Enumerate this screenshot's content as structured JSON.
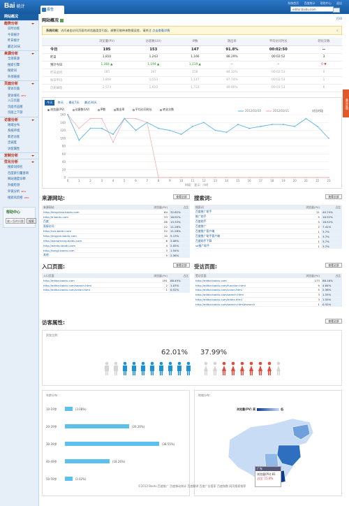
{
  "header": {
    "logo": "Bai",
    "logo_sub": "统计",
    "home_tab": "报告",
    "links": [
      "系统首页",
      "百度统计",
      "帮助中心",
      "退出"
    ],
    "site": "editor.baidu.com"
  },
  "sidebar": {
    "current": "网站概况",
    "groups": [
      {
        "title": "趋势分析",
        "items": [
          "实时访客",
          "今日统计",
          "昨日统计",
          "最近30天"
        ]
      },
      {
        "title": "来源分析",
        "items": [
          "全部来源",
          "搜索引擎",
          "搜索词",
          "外部链接"
        ]
      },
      {
        "title": "页面分析",
        "items": [
          "受访页面",
          "受访域名",
          "入口页面",
          "页面点击图",
          "页面上下游"
        ]
      },
      {
        "title": "访客分析",
        "items": [
          "地域分布",
          "系统环境",
          "新老访客",
          "忠诚度",
          "访客属性"
        ]
      },
      {
        "title": "定制分析",
        "items": []
      },
      {
        "title": "优化分析",
        "items": [
          "搜索词排名",
          "百度索引量查询",
          "网站速度诊断",
          "升级检测",
          "外链分析",
          "搜索风云榜"
        ]
      }
    ],
    "new_badge": "NEW"
  },
  "help": {
    "title": "帮助中心",
    "placeholder": "输入您的问题",
    "button": "搜索"
  },
  "page": {
    "title": "网站概况",
    "print": "打印"
  },
  "alert": {
    "prefix": "系统问候：",
    "text": "访问者由访问页面的浏览器类型引起，调整可能带来数据误差，请关注",
    "link": "点击查看详情"
  },
  "summary": {
    "headers": [
      "",
      "浏览量(PV)",
      "访客数(UV)",
      "IP数",
      "跳出率",
      "平均访问时长",
      "转化次数"
    ],
    "rows": [
      {
        "label": "今日",
        "vals": [
          "195",
          "153",
          "147",
          "91.8%",
          "00:02:50",
          "--"
        ],
        "cls": "big"
      },
      {
        "label": "昨日",
        "vals": [
          "1,810",
          "1,243",
          "1,166",
          "88.29%",
          "00:02:52",
          "3"
        ],
        "cls": ""
      },
      {
        "label": "预计今日",
        "vals": [
          "1,384 ▲",
          "1,194 ▲",
          "1,119 ▲",
          "--",
          "--",
          "0 ▼"
        ],
        "cls": ""
      },
      {
        "label": "昨日此时",
        "vals": [
          "185",
          "167",
          "158",
          "84.32%",
          "00:02:53",
          "0"
        ],
        "cls": "gray"
      },
      {
        "label": "每日平均",
        "vals": [
          "1,809",
          "1,553",
          "1,117",
          "87.74%",
          "00:02:53",
          "1"
        ],
        "cls": "gray"
      },
      {
        "label": "历史峰值",
        "vals": [
          "2,573",
          "1,610",
          "1,722",
          "89.90%",
          "00:03:53",
          "6"
        ],
        "cls": "gray"
      }
    ]
  },
  "trend": {
    "tabs": [
      "今天",
      "昨天",
      "最近7天",
      "最近30天"
    ],
    "metrics": [
      "浏览量(PV)",
      "访客数(UV)",
      "IP数",
      "跳出率",
      "平均访问时长",
      "转化次数"
    ],
    "legend_a": "2012/03/10",
    "legend_b": "2012/03/11",
    "compare": "对比时段",
    "xlabel": "时段：  显示：小时",
    "xticks": [
      "0",
      "1",
      "2",
      "3",
      "4",
      "5",
      "6",
      "7",
      "8",
      "9",
      "10",
      "11",
      "12",
      "13",
      "14",
      "15",
      "16",
      "17",
      "18",
      "19",
      "20",
      "21",
      "22",
      "23"
    ],
    "yticks": [
      "0",
      "20",
      "40",
      "60",
      "80",
      "100",
      "120",
      "140",
      "160"
    ]
  },
  "sources": {
    "title": "来源网站:",
    "btn": "查看全部",
    "headers": [
      "来源网站",
      "浏览量(PV)",
      "占比"
    ],
    "rows": [
      [
        "http://fengchao.baidu.com",
        64,
        "32.82%"
      ],
      [
        "http://e.baidu.com",
        33,
        "16.92%"
      ],
      [
        "百度",
        26,
        "13.33%"
      ],
      [
        "直接访问",
        22,
        "11.28%"
      ],
      [
        "http://cas.baidu.com",
        22,
        "11.28%"
      ],
      [
        "http://jingyan.baidu.com",
        10,
        "5.13%"
      ],
      [
        "http://wangmeng.baidu.com",
        6,
        "3.08%"
      ],
      [
        "http://wenku.baidu.com",
        4,
        "2.05%"
      ],
      [
        "http://tongji.baidu.com",
        3,
        "1.54%"
      ],
      [
        "其他",
        5,
        "2.56%"
      ]
    ]
  },
  "keywords": {
    "title": "搜索词:",
    "btn": "查看全部",
    "headers": [
      "搜索词",
      "浏览量(PV)",
      "占比"
    ],
    "rows": [
      [
        "百度推广助手",
        11,
        "40.74%"
      ],
      [
        "推广助手",
        5,
        "18.52%"
      ],
      [
        "百度助手",
        5,
        "18.52%"
      ],
      [
        "百度推广",
        2,
        "7.41%"
      ],
      [
        "百度推广客户端",
        1,
        "3.7%"
      ],
      [
        "百度推广助手客户端",
        1,
        "3.7%"
      ],
      [
        "百度助手下载",
        1,
        "3.7%"
      ],
      [
        "sd推广助手",
        1,
        "3.7%"
      ]
    ]
  },
  "entry": {
    "title": "入口页面:",
    "btn": "查看全部",
    "headers": [
      "入口页面",
      "浏览量(PV)",
      "占比"
    ],
    "rows": [
      [
        "http://editor.baidu.com",
        191,
        "68.45%"
      ],
      [
        "http://editor.baidu.com/search.html",
        2,
        "1.03%"
      ],
      [
        "http://editor.baidu.com/union.html",
        1,
        "0.52%"
      ]
    ]
  },
  "visited": {
    "title": "受访页面:",
    "btn": "查看全部",
    "headers": [
      "受访页面",
      "浏览量(PV)",
      "占比"
    ],
    "rows": [
      [
        "http://editor.baidu.com",
        173,
        "88.16%"
      ],
      [
        "http://editor.baidu.com/function.html",
        9,
        "4.64%"
      ],
      [
        "http://editor.baidu.com/union.html",
        5,
        "2.58%"
      ],
      [
        "http://editor.baidu.com/search.html",
        3,
        "1.55%"
      ],
      [
        "http://editor.baidu.com/index.html",
        3,
        "1.55%"
      ],
      [
        "http://editor.baidu.com/search.html#search",
        1,
        "0.52%"
      ]
    ]
  },
  "visitors": {
    "title": "访客属性:",
    "btn": "查看全部",
    "gender_label": "男女比例：",
    "male": "62.01%",
    "female": "37.99%",
    "male_ratio": 0.6201,
    "age_label": "年龄分布：",
    "ages": [
      {
        "label": "10-19岁",
        "pct": 3.08
      },
      {
        "label": "20-29岁",
        "pct": 26.26
      },
      {
        "label": "30-39岁",
        "pct": 38.55
      },
      {
        "label": "40-49岁",
        "pct": 18.26
      },
      {
        "label": "50-59岁",
        "pct": 3.02
      }
    ],
    "map_label": "地域分布：",
    "map_legend_lo": "浏览量(PV) 高",
    "map_legend_hi": "低",
    "tip_region": "广东",
    "tip_pv": "浏览量(PV):81",
    "tip_pct": "占比: 15.8%"
  },
  "footer": "©2013 Baidu  百度推广  百度移动统计  百度翻译  百度广告管家  百度指数  网页搜索推荐",
  "sidetab": "意见反馈",
  "colors": {
    "brand": "#1a5ea3",
    "accent": "#b6270f",
    "male": "#1e90d6",
    "female": "#e04a3a"
  },
  "chart_data": {
    "type": "line",
    "x": [
      0,
      1,
      2,
      3,
      4,
      5,
      6,
      7,
      8,
      9,
      10,
      11,
      12,
      13,
      14,
      15,
      16,
      17,
      18,
      19,
      20,
      21,
      22,
      23
    ],
    "series": [
      {
        "name": "2012/03/10",
        "values": [
          160,
          125,
          150,
          150,
          90,
          150,
          150,
          140,
          0,
          0,
          0,
          0,
          0,
          0,
          0,
          0,
          0,
          0,
          0,
          0,
          0,
          0,
          0,
          0
        ]
      },
      {
        "name": "2012/03/11",
        "values": [
          160,
          95,
          125,
          125,
          110,
          150,
          120,
          140,
          125,
          120,
          110,
          130,
          140,
          120,
          115,
          135,
          125,
          130,
          135,
          135,
          130,
          150,
          130,
          100
        ]
      }
    ],
    "ylim": [
      0,
      160
    ]
  }
}
